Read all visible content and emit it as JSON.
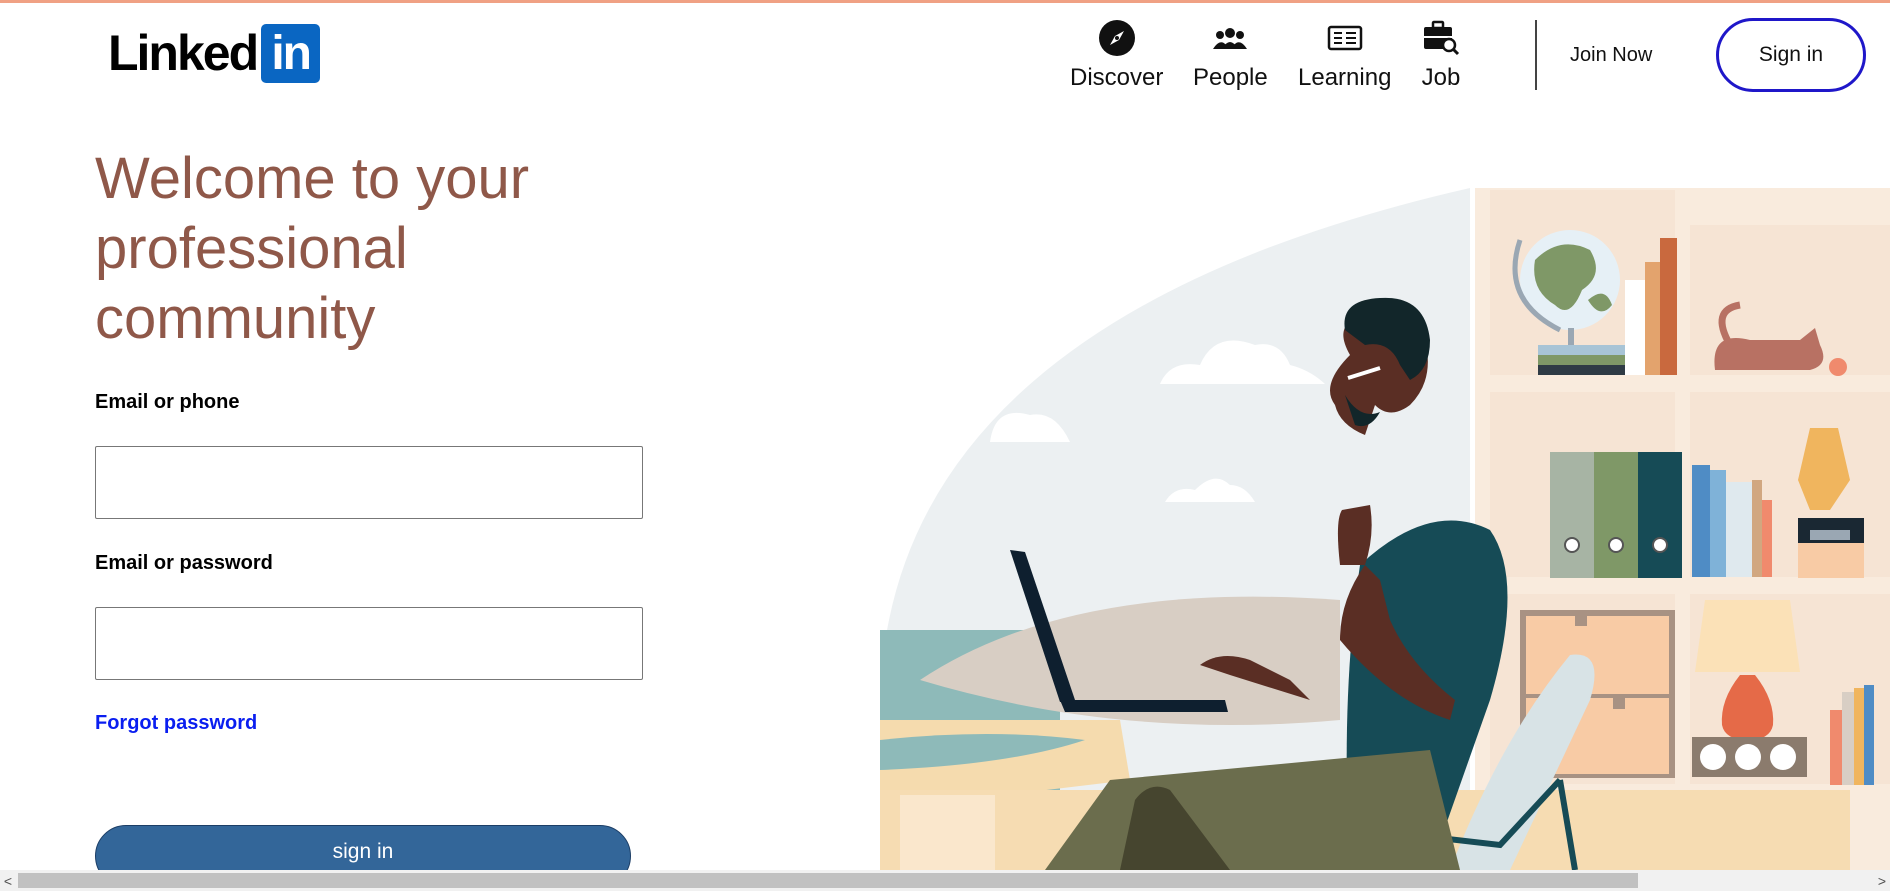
{
  "brand": {
    "logo_text": "Linked",
    "logo_box_text": "in",
    "accent_color": "#0a66c2",
    "top_border_color": "#f0a184"
  },
  "nav": {
    "items": [
      {
        "label": "Discover",
        "icon": "compass-icon"
      },
      {
        "label": "People",
        "icon": "people-icon"
      },
      {
        "label": "Learning",
        "icon": "learning-icon"
      },
      {
        "label": "Job",
        "icon": "briefcase-search-icon"
      }
    ],
    "join_now": "Join Now",
    "sign_in": "Sign in"
  },
  "hero": {
    "headline": "Welcome to your professional community",
    "headline_color": "#8f5849"
  },
  "form": {
    "email_label": "Email or phone",
    "email_value": "",
    "password_label": "Email or password",
    "password_value": "",
    "forgot_password": "Forgot password",
    "submit": "sign in",
    "submit_color": "#336699"
  },
  "scrollbar": {
    "left_arrow": "<",
    "right_arrow": ">"
  }
}
